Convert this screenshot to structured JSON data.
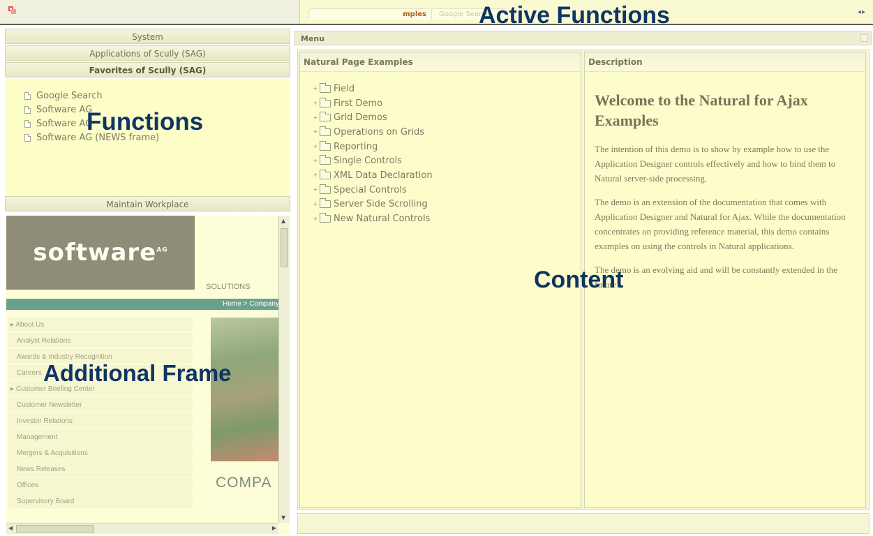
{
  "top": {
    "tabs": [
      {
        "label": "mples"
      },
      {
        "label": "Google Search"
      }
    ],
    "scroll_arrows": "◂▸"
  },
  "left": {
    "accordion": [
      {
        "label": "System"
      },
      {
        "label": "Applications of Scully (SAG)"
      },
      {
        "label": "Favorites of Scully (SAG)"
      }
    ],
    "favorites": [
      {
        "label": "Google Search"
      },
      {
        "label": "Software AG"
      },
      {
        "label": "Software AG"
      },
      {
        "label": "Software AG (NEWS frame)"
      }
    ],
    "maintain_label": "Maintain Workplace"
  },
  "frame": {
    "logo": "software",
    "logo_sup": "AG",
    "solutions": "SOLUTIONS",
    "crumb": "Home > Company",
    "nav": [
      "About Us",
      "Analyst Relations",
      "Awards & Industry Recognition",
      "Careers",
      "Customer Briefing Center",
      "Customer Newsletter",
      "Investor Relations",
      "Management",
      "Mergers & Acquisitions",
      "News Releases",
      "Offices",
      "Supervisory Board"
    ],
    "compa": "COMPA"
  },
  "main": {
    "menu_label": "Menu",
    "left_title": "Natural Page Examples",
    "right_title": "Description",
    "tree": [
      "Field",
      "First Demo",
      "Grid Demos",
      "Operations on Grids",
      "Reporting",
      "Single Controls",
      "XML Data Declaration",
      "Special Controls",
      "Server Side Scrolling",
      "New Natural Controls"
    ],
    "desc_title": "Welcome to the Natural for Ajax Examples",
    "desc_paragraphs": [
      "The intention of this demo is to show by example how to use the Application Designer controls effectively and how to bind them to Natural server-side processing.",
      "The demo is an extension of the documentation that comes with Application Designer and Natural for Ajax. While the documentation concentrates on providing reference material, this demo contains examples on using the controls in Natural applications.",
      "The demo is an evolving aid and will be constantly extended in the future."
    ]
  },
  "annotations": {
    "active_functions": "Active Functions",
    "functions": "Functions",
    "content": "Content",
    "additional_frame": "Additional Frame"
  }
}
